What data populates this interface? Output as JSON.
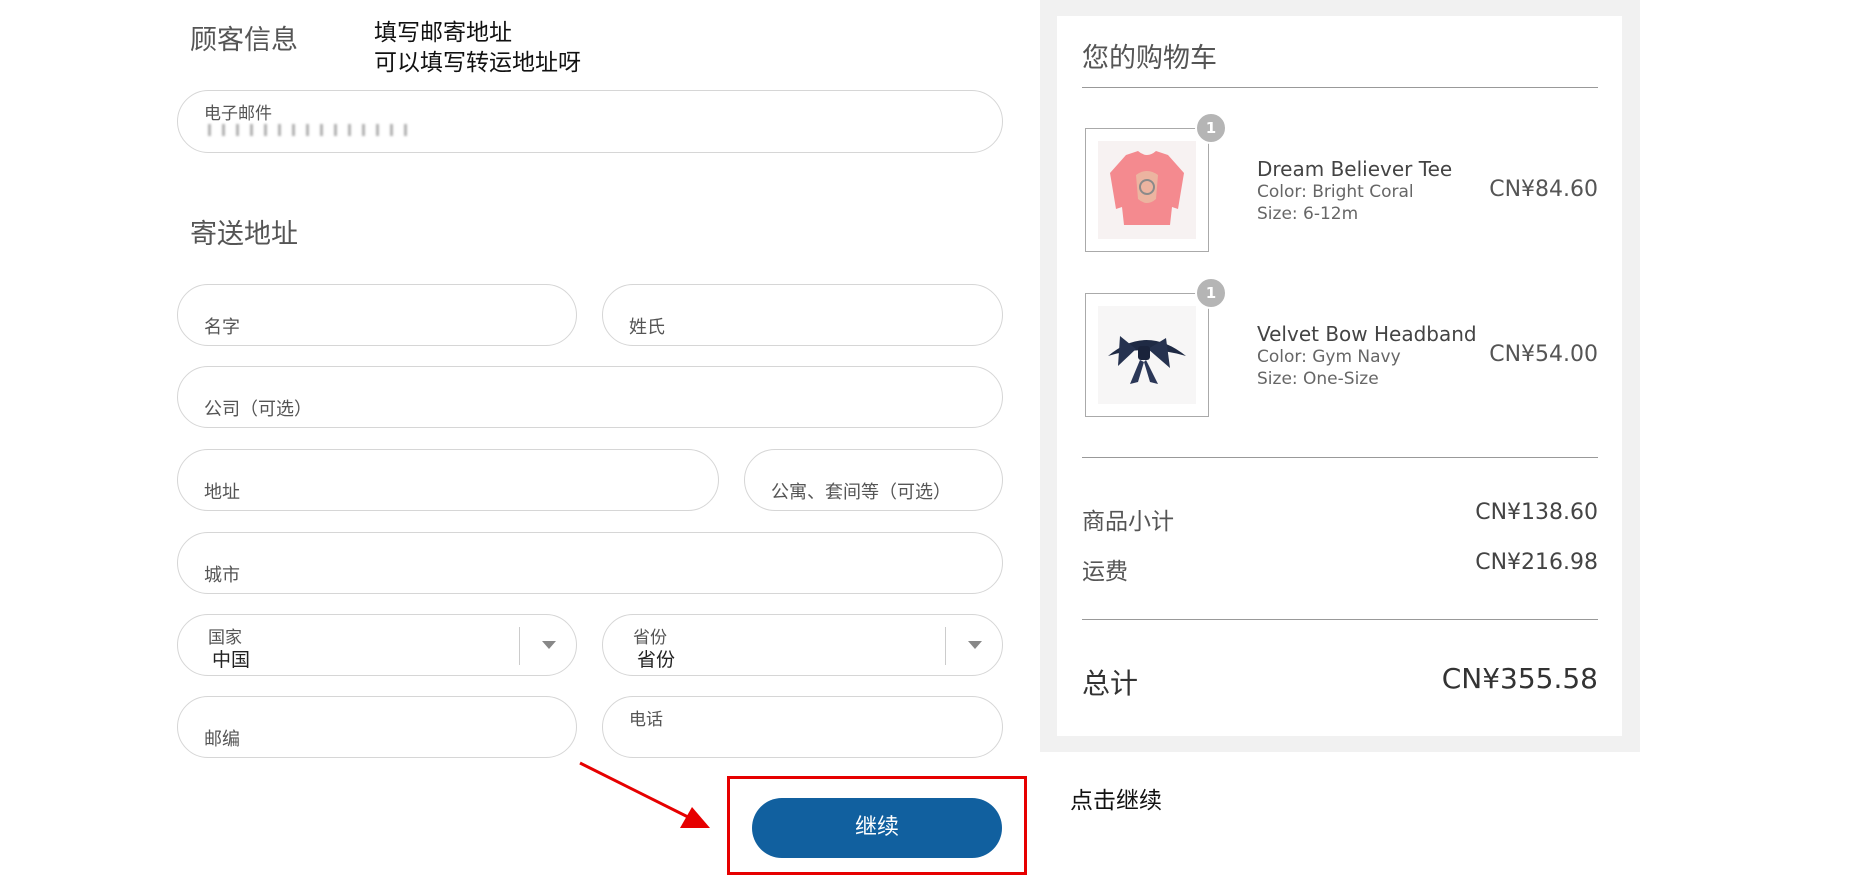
{
  "customer": {
    "section_title": "顾客信息",
    "email": {
      "label": "电子邮件"
    }
  },
  "annotations": {
    "note_line1": "填写邮寄地址",
    "note_line2": "可以填写转运地址呀",
    "click_note": "点击继续"
  },
  "shipping": {
    "section_title": "寄送地址",
    "first_name_label": "名字",
    "last_name_label": "姓氏",
    "company_label": "公司（可选）",
    "address_label": "地址",
    "apartment_label": "公寓、套间等（可选）",
    "city_label": "城市",
    "country": {
      "label": "国家",
      "value": "中国"
    },
    "province": {
      "label": "省份",
      "value": "省份"
    },
    "postcode_label": "邮编",
    "phone_label": "电话"
  },
  "cart": {
    "title": "您的购物车",
    "items": [
      {
        "qty": "1",
        "name": "Dream Believer Tee",
        "color": "Color: Bright Coral",
        "size": "Size: 6-12m",
        "price": "CN¥84.60"
      },
      {
        "qty": "1",
        "name": "Velvet Bow Headband",
        "color": "Color: Gym Navy",
        "size": "Size: One-Size",
        "price": "CN¥54.00"
      }
    ],
    "subtotal_label": "商品小计",
    "subtotal_value": "CN¥138.60",
    "shipping_label": "运费",
    "shipping_value": "CN¥216.98",
    "total_label": "总计",
    "total_value": "CN¥355.58"
  },
  "actions": {
    "continue_label": "继续"
  },
  "colors": {
    "primary_button": "#11609f",
    "annotation_red": "#e60000",
    "badge": "#b5b5b5"
  }
}
